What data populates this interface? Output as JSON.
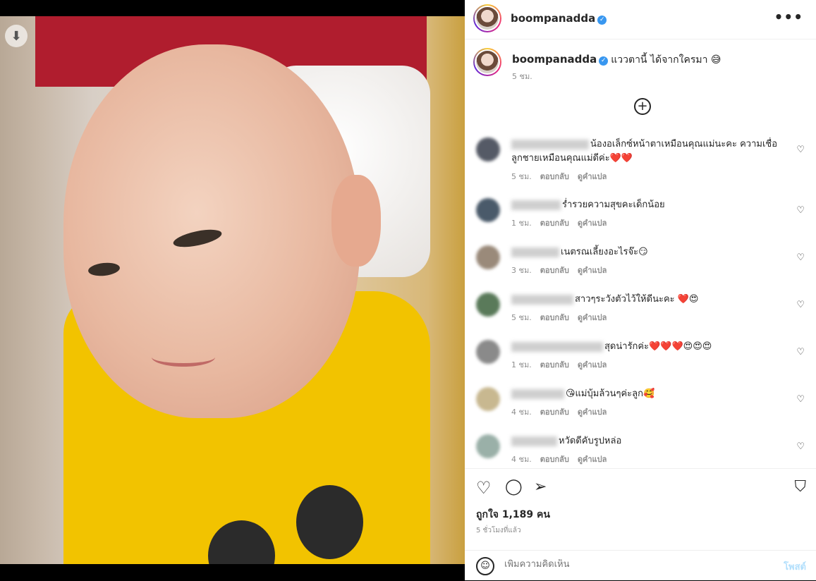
{
  "media": {
    "download_icon": "arrow-down-icon",
    "download_glyph": "⬇"
  },
  "header": {
    "username": "boompanadda",
    "verified_glyph": "✓",
    "more_glyph": "•••"
  },
  "caption": {
    "username": "boompanadda",
    "text": "แววตานี้ ได้จากใครมา 😅",
    "time": "5 ชม."
  },
  "load_more": {
    "glyph": "+"
  },
  "comments": [
    {
      "line1": "น้องอเล็กซ์หน้าตาเหมือนคุณแม่นะคะ ความเชื่อ",
      "line2": "ลูกชายเหมือนคุณแม่ดีค่ะ❤️❤️",
      "time": "5 ชม.",
      "reply": "ตอบกลับ",
      "translate": "ดูคำแปล",
      "avatar_color": "#555a66"
    },
    {
      "line1": "ร่ำรวยความสุขคะเด็กน้อย",
      "line2": "",
      "time": "1 ชม.",
      "reply": "ตอบกลับ",
      "translate": "ดูคำแปล",
      "avatar_color": "#4a5a6a"
    },
    {
      "line1": "เนตรณเลี้ยงอะไรจ๊ะ😏",
      "line2": "",
      "time": "3 ชม.",
      "reply": "ตอบกลับ",
      "translate": "ดูคำแปล",
      "avatar_color": "#9a8a7a"
    },
    {
      "line1": "สาวๆระวังตัวไว้ให้ดีนะคะ ❤️😍",
      "line2": "",
      "time": "5 ชม.",
      "reply": "ตอบกลับ",
      "translate": "ดูคำแปล",
      "avatar_color": "#5a7a5a"
    },
    {
      "line1": "สุดน่ารักค่ะ❤️❤️❤️😍😍😍",
      "line2": "",
      "time": "1 ชม.",
      "reply": "ตอบกลับ",
      "translate": "ดูคำแปล",
      "avatar_color": "#8a8a8a"
    },
    {
      "line1": "😘แม่บุ้มล้วนๆค่ะลูก🥰",
      "line2": "",
      "time": "4 ชม.",
      "reply": "ตอบกลับ",
      "translate": "ดูคำแปล",
      "avatar_color": "#c8b890"
    },
    {
      "line1": "หวัดดีคับรูปหล่อ",
      "line2": "",
      "time": "4 ชม.",
      "reply": "ตอบกลับ",
      "translate": "ดูคำแปล",
      "avatar_color": "#9ab0a8"
    }
  ],
  "actions": {
    "like_glyph": "♡",
    "comment_glyph": "◯",
    "share_glyph": "➢",
    "save_glyph": "⛉"
  },
  "likes": {
    "text": "ถูกใจ 1,189 คน"
  },
  "ago": {
    "text": "5 ชั่วโมงที่แล้ว"
  },
  "add_comment": {
    "emoji_glyph": "☺",
    "placeholder": "เพิ่มความคิดเห็น",
    "post_label": "โพสต์"
  }
}
